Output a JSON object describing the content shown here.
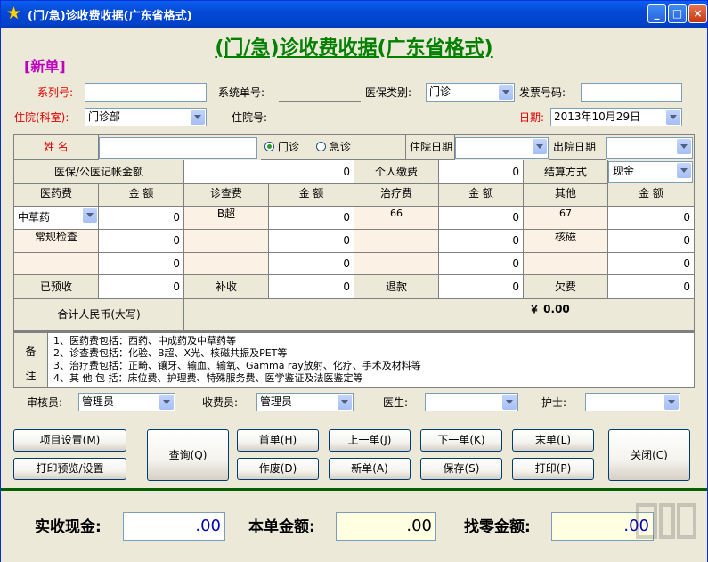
{
  "window": {
    "title": "(门/急)诊收费收据(广东省格式)"
  },
  "header": {
    "big_title": "(门/急)诊收费收据(广东省格式)",
    "new_label": "[新单]"
  },
  "top_fields": {
    "serial_label": "系列号:",
    "serial_value": "",
    "system_no_label": "系统单号:",
    "system_no_value": "",
    "insurance_type_label": "医保类别:",
    "insurance_type_value": "门诊",
    "invoice_no_label": "发票号码:",
    "invoice_no_value": "",
    "dept_label": "住院(科室):",
    "dept_value": "门诊部",
    "inpatient_no_label": "住院号:",
    "inpatient_no_value": "",
    "date_label": "日期:",
    "date_value": "2013年10月29日"
  },
  "patient": {
    "name_label": "姓  名",
    "name_value": "",
    "radio_outpatient": "门诊",
    "radio_emergency": "急诊",
    "admission_date_label": "住院日期",
    "discharge_date_label": "出院日期",
    "insurance_amount_label": "医保/公医记帐金额",
    "insurance_amount_value": "0",
    "personal_pay_label": "个人缴费",
    "personal_pay_value": "0",
    "settle_method_label": "结算方式",
    "settle_method_value": "现金"
  },
  "fee_table": {
    "headers": [
      "医药费",
      "金    额",
      "诊查费",
      "金    额",
      "治疗费",
      "金    额",
      "其他",
      "金    额"
    ],
    "rows": [
      [
        "中草药",
        "0",
        "B超",
        "0",
        "66",
        "0",
        "67",
        "0"
      ],
      [
        "常规检查",
        "0",
        "",
        "0",
        "",
        "0",
        "核磁",
        "0"
      ],
      [
        "",
        "0",
        "",
        "0",
        "",
        "0",
        "",
        "0"
      ]
    ],
    "prepaid_label": "已预收",
    "prepaid_value": "0",
    "supplement_label": "补收",
    "supplement_value": "0",
    "refund_label": "退款",
    "refund_value": "0",
    "owed_label": "欠费",
    "owed_value": "0",
    "total_rmb_label": "合计人民币(大写)",
    "total_value": "￥ 0.00"
  },
  "notes": {
    "label_1": "备",
    "label_2": "注",
    "lines": [
      "1、医药费包括：西药、中成药及中草药等",
      "2、诊查费包括：化验、B超、X光、核磁共振及PET等",
      "3、治疗费包括：正畸、镶牙、输血、输氧、Gamma ray放射、化疗、手术及材料等",
      "4、其 他 包 括：床位费、护理费、特殊服务费、医学鉴证及法医鉴定等"
    ]
  },
  "staff": {
    "auditor_label": "审核员:",
    "auditor_value": "管理员",
    "cashier_label": "收费员:",
    "cashier_value": "管理员",
    "doctor_label": "医生:",
    "doctor_value": "",
    "nurse_label": "护士:",
    "nurse_value": ""
  },
  "buttons": {
    "item_settings": "项目设置(M)",
    "print_preview": "打印预览/设置",
    "query": "查询(Q)",
    "first": "首单(H)",
    "prev": "上一单(J)",
    "next": "下一单(K)",
    "last": "末单(L)",
    "void": "作废(D)",
    "new": "新单(A)",
    "save": "保存(S)",
    "print": "打印(P)",
    "close": "关闭(C)"
  },
  "totals": {
    "cash_label": "实收现金:",
    "cash_value": ".00",
    "amount_label": "本单金额:",
    "amount_value": ".00",
    "change_label": "找零金额:",
    "change_value": ".00"
  },
  "colors": {
    "title_green": "#008000",
    "label_red": "#e00000",
    "new_magenta": "#c000c0",
    "cell_peach": "#fbf1e4",
    "field_yellow": "#ffffe1"
  }
}
